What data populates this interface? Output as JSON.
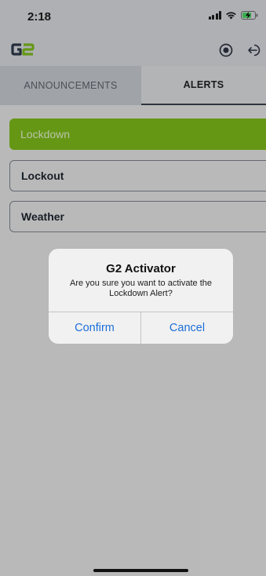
{
  "status_bar": {
    "time": "2:18",
    "icons": [
      "signal-icon",
      "wifi-icon",
      "battery-charging-icon"
    ]
  },
  "header": {
    "logo_text": "G2",
    "logo_color": "#7fbd1b",
    "buttons": [
      "stop-circle-icon",
      "logout-icon"
    ]
  },
  "tabs": [
    {
      "label": "ANNOUNCEMENTS",
      "selected": false
    },
    {
      "label": "ALERTS",
      "selected": true
    }
  ],
  "alerts": [
    {
      "label": "Lockdown",
      "selected": true
    },
    {
      "label": "Lockout",
      "selected": false
    },
    {
      "label": "Weather",
      "selected": false
    }
  ],
  "dialog": {
    "title": "G2 Activator",
    "message": "Are you sure you want to activate the Lockdown Alert?",
    "confirm_label": "Confirm",
    "cancel_label": "Cancel"
  },
  "colors": {
    "accent": "#7fbd1b",
    "link": "#1b6fd8"
  }
}
